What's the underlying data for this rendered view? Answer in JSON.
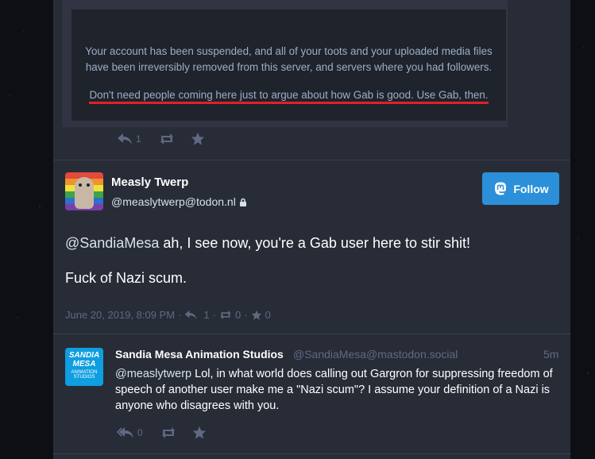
{
  "notice": {
    "line1": "Your account has been suspended, and all of your toots and your uploaded media files have been irreversibly removed from this server, and servers where you had followers.",
    "line2": "Don't need people coming here just to argue about how Gab is good. Use Gab, then."
  },
  "quoted_actions": {
    "reply_count": "1"
  },
  "status": {
    "display_name": "Measly Twerp",
    "handle": "@measlytwerp@todon.nl",
    "follow_label": "Follow",
    "mention": "@SandiaMesa",
    "text1": " ah, I see now, you're a Gab user here to stir shit!",
    "text2": "Fuck of Nazi scum.",
    "timestamp": "June 20, 2019, 8:09 PM",
    "sep": "·",
    "replies": "1",
    "boosts": "0",
    "favourites": "0"
  },
  "reply": {
    "avatar_line1": "SANDIA",
    "avatar_line2": "MESA",
    "avatar_line3": "ANIMATION",
    "avatar_line4": "STUDIOS",
    "display_name": "Sandia Mesa Animation Studios",
    "acct": "@SandiaMesa@mastodon.social",
    "time": "5m",
    "mention": "@measlytwerp",
    "text": " Lol, in what world does calling out Gargron for suppressing freedom of speech of another user make me a \"Nazi scum\"? I assume your definition of a Nazi is anyone who disagrees with you.",
    "reply_count": "0"
  },
  "colors": {
    "accent": "#2b90d9",
    "column": "#282c37",
    "muted": "#606984",
    "underline": "#e0202a"
  }
}
